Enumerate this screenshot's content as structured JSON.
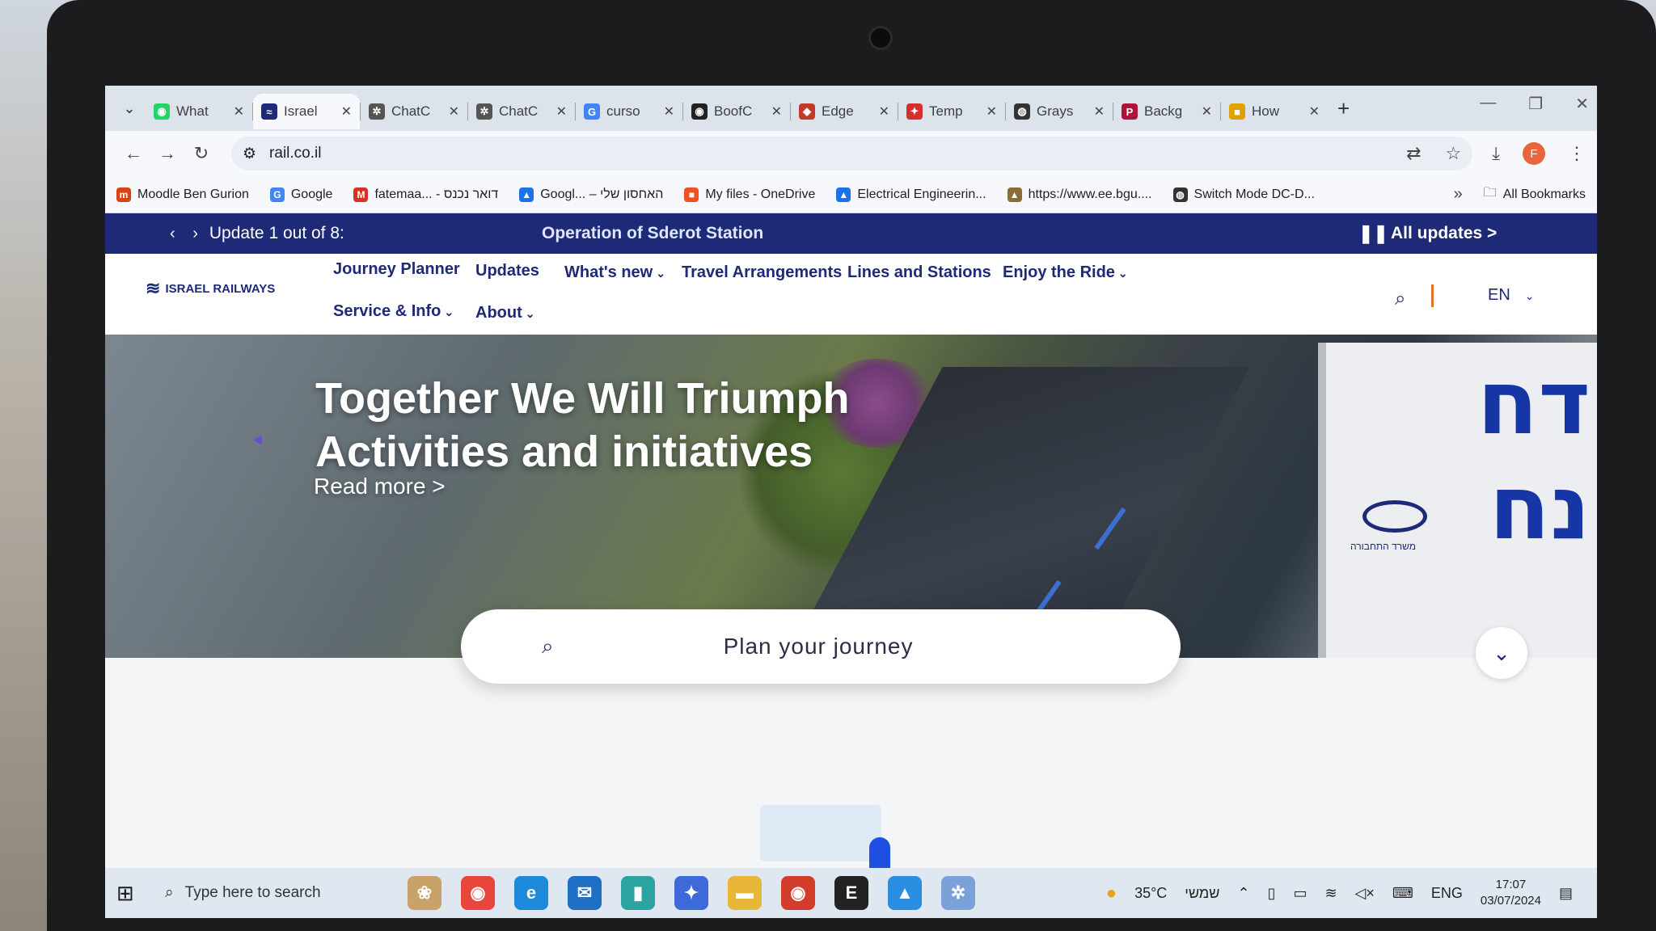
{
  "browser": {
    "tabs": [
      {
        "title": "What",
        "icon": "whatsapp-icon",
        "color": "#25d366",
        "glyph": "◉"
      },
      {
        "title": "Israel",
        "icon": "train-icon",
        "color": "#1e2a78",
        "glyph": "≈",
        "active": true
      },
      {
        "title": "ChatC",
        "icon": "chatgpt-icon",
        "color": "#555555",
        "glyph": "✲"
      },
      {
        "title": "ChatC",
        "icon": "chatgpt-icon",
        "color": "#555555",
        "glyph": "✲"
      },
      {
        "title": "curso",
        "icon": "google-icon",
        "color": "#4285f4",
        "glyph": "G"
      },
      {
        "title": "BoofC",
        "icon": "github-icon",
        "color": "#222222",
        "glyph": "◉"
      },
      {
        "title": "Edge",
        "icon": "edge-extension-icon",
        "color": "#c0392b",
        "glyph": "◆"
      },
      {
        "title": "Temp",
        "icon": "pdf-icon",
        "color": "#d62d2d",
        "glyph": "✦"
      },
      {
        "title": "Grays",
        "icon": "globe-icon",
        "color": "#333333",
        "glyph": "◍"
      },
      {
        "title": "Backg",
        "icon": "p-icon",
        "color": "#b0123a",
        "glyph": "P"
      },
      {
        "title": "How",
        "icon": "colorful-icon",
        "color": "#e0a100",
        "glyph": "■"
      }
    ],
    "tab_close": "✕",
    "new_tab": "+",
    "url": "rail.co.il",
    "bookmarks": [
      {
        "label": "Moodle Ben Gurion",
        "color": "#d84315",
        "glyph": "m"
      },
      {
        "label": "Google",
        "color": "#4285f4",
        "glyph": "G"
      },
      {
        "label": "fatemaa... - דואר נכנס",
        "color": "#d93025",
        "glyph": "M"
      },
      {
        "label": "Googl... – האחסון שלי",
        "color": "#1a73e8",
        "glyph": "▲"
      },
      {
        "label": "My files - OneDrive",
        "color": "#f25022",
        "glyph": "■"
      },
      {
        "label": "Electrical Engineerin...",
        "color": "#1a73e8",
        "glyph": "▲"
      },
      {
        "label": "https://www.ee.bgu....",
        "color": "#8a6d3b",
        "glyph": "▲"
      },
      {
        "label": "Switch Mode DC-D...",
        "color": "#333333",
        "glyph": "◍"
      }
    ],
    "bookmarks_more": "»",
    "all_bookmarks": "All Bookmarks"
  },
  "page": {
    "update_nav": "‹ ›",
    "update_count": "Update 1 out of 8:",
    "update_title": "Operation of Sderot Station",
    "pause_glyph": "❚❚",
    "all_updates": "All updates  >",
    "logo_text": "ISRAEL RAILWAYS",
    "nav": {
      "journey_planner": "Journey Planner",
      "updates": "Updates",
      "whats_new": "What's new",
      "travel": "Travel Arrangements",
      "lines": "Lines and Stations",
      "enjoy": "Enjoy the Ride",
      "service": "Service & Info",
      "about": "About",
      "lang": "EN"
    },
    "hero": {
      "title_line1": "Together We Will Triumph",
      "title_line2": "Activities and initiatives",
      "read_more": "Read more >",
      "sign_top": "דח",
      "sign_bottom": "נח",
      "sign_caption": "משרד התחבורה"
    },
    "journey_placeholder": "Plan your journey"
  },
  "taskbar": {
    "search_placeholder": "Type here to search",
    "weather": "35°C",
    "weather_day": "שמשי",
    "lang": "ENG",
    "time": "17:07",
    "date": "03/07/2024"
  },
  "colors": {
    "brand_navy": "#1e2a78",
    "accent_orange": "#e86c2a"
  }
}
